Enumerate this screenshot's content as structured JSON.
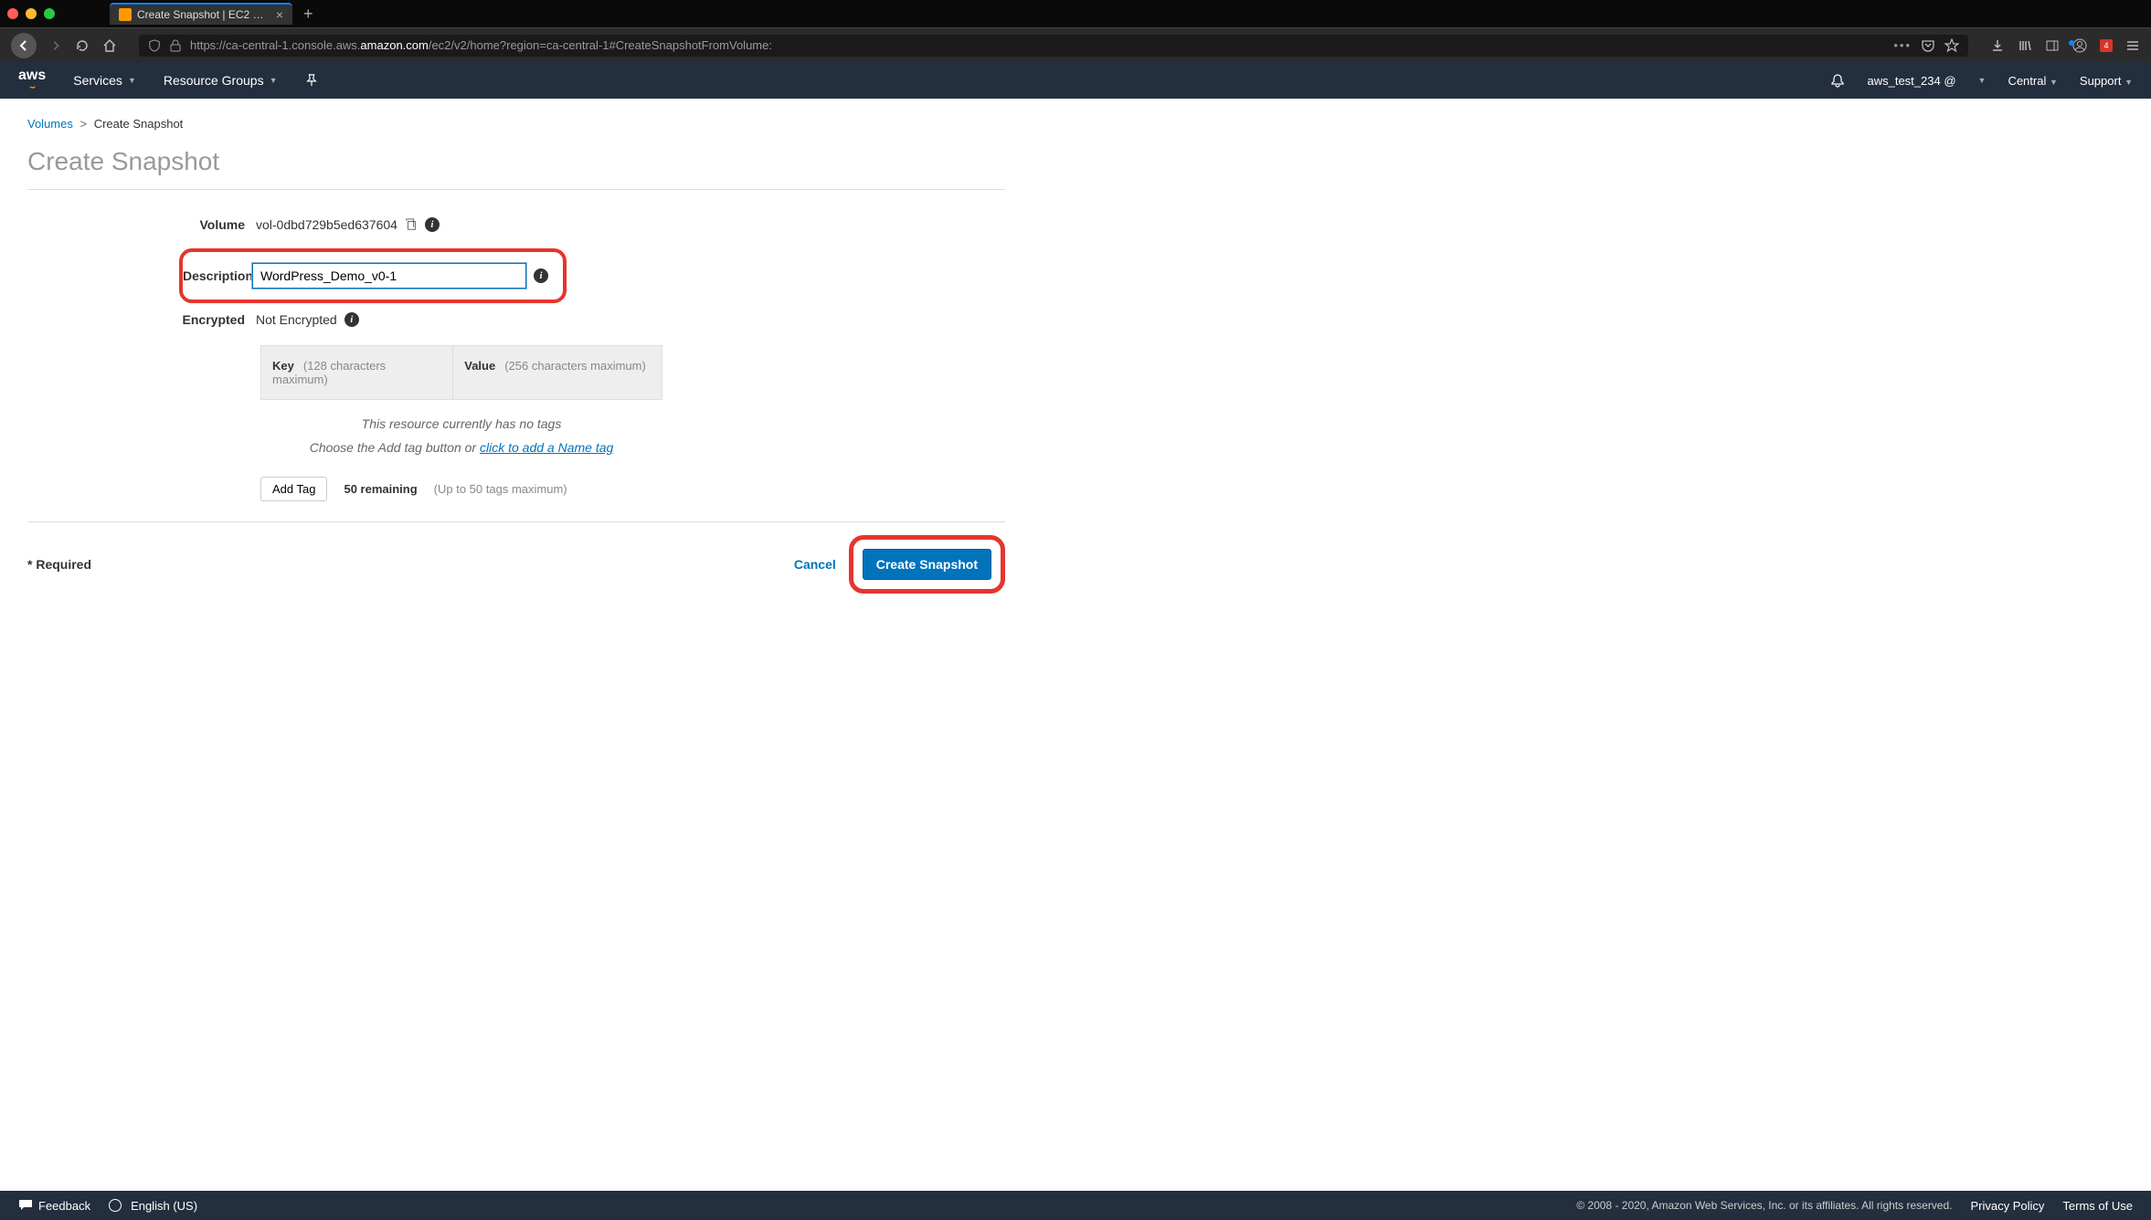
{
  "browser": {
    "tab_title": "Create Snapshot | EC2 Manage",
    "url_prefix": "https://ca-central-1.console.aws.",
    "url_bold": "amazon.com",
    "url_suffix": "/ec2/v2/home?region=ca-central-1#CreateSnapshotFromVolume:",
    "badge": "4"
  },
  "nav": {
    "logo": "aws",
    "services": "Services",
    "resource_groups": "Resource Groups",
    "account": "aws_test_234 @",
    "region": "Central",
    "support": "Support"
  },
  "breadcrumb": {
    "volumes": "Volumes",
    "sep": ">",
    "current": "Create Snapshot"
  },
  "page_title": "Create Snapshot",
  "form": {
    "volume_label": "Volume",
    "volume_value": "vol-0dbd729b5ed637604",
    "description_label": "Description",
    "description_value": "WordPress_Demo_v0-1",
    "encrypted_label": "Encrypted",
    "encrypted_value": "Not Encrypted"
  },
  "tags": {
    "key_label": "Key",
    "key_hint": "(128 characters maximum)",
    "value_label": "Value",
    "value_hint": "(256 characters maximum)",
    "empty_msg": "This resource currently has no tags",
    "choose_prefix": "Choose the Add tag button or ",
    "choose_link": "click to add a Name tag",
    "add_tag_btn": "Add Tag",
    "remaining": "50 remaining",
    "max_hint": "(Up to 50 tags maximum)"
  },
  "actions": {
    "required": "* Required",
    "cancel": "Cancel",
    "submit": "Create Snapshot"
  },
  "footer": {
    "feedback": "Feedback",
    "language": "English (US)",
    "copyright": "© 2008 - 2020, Amazon Web Services, Inc. or its affiliates. All rights reserved.",
    "privacy": "Privacy Policy",
    "terms": "Terms of Use"
  }
}
